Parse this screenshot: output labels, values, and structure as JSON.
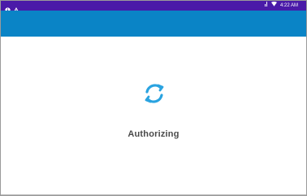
{
  "status_bar": {
    "time": "4:22 AM",
    "left_icons": [
      "info-icon",
      "warning-icon"
    ],
    "right_icons": [
      "signal-icon",
      "wifi-icon"
    ],
    "color": "#4a1aa8"
  },
  "app_bar": {
    "color": "#0a84c6"
  },
  "loading": {
    "label": "Authorizing",
    "spinner_color": "#2aa3e0"
  }
}
